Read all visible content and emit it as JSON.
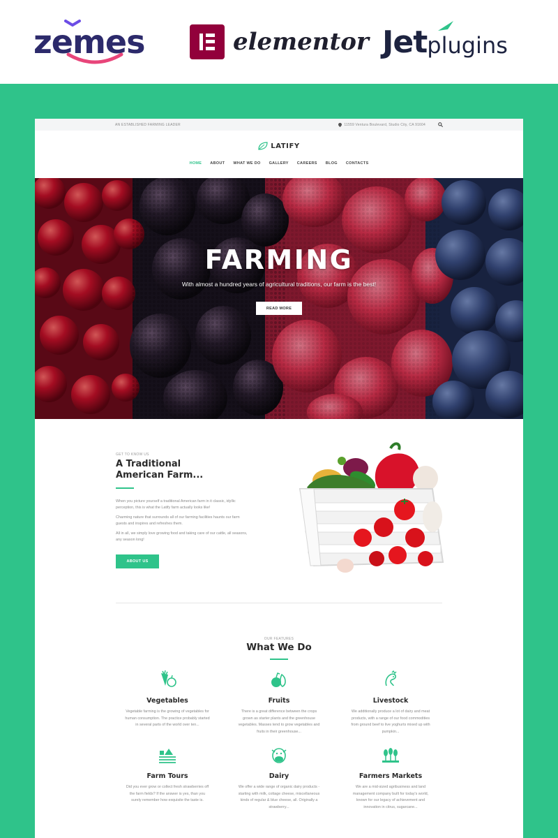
{
  "brand_bar": {
    "zemes": "zemes",
    "elementor": "elementor",
    "jet": "Jet",
    "plugins": "plugins"
  },
  "topbar": {
    "tagline": "AN ESTABLISHED FARMING LEADER",
    "address": "11559 Ventura Boulevard, Studio City, CA 91604"
  },
  "logo": {
    "text": "LATIFY"
  },
  "nav": {
    "items": [
      {
        "label": "HOME",
        "active": true
      },
      {
        "label": "ABOUT"
      },
      {
        "label": "WHAT WE DO"
      },
      {
        "label": "GALLERY"
      },
      {
        "label": "CAREERS"
      },
      {
        "label": "BLOG"
      },
      {
        "label": "CONTACTS"
      }
    ]
  },
  "hero": {
    "title": "FARMING",
    "subtitle": "With almost a hundred years of agricultural traditions, our farm is the best!",
    "button": "READ MORE"
  },
  "about": {
    "eyebrow": "GET TO KNOW US",
    "title_line1": "A Traditional",
    "title_line2": "American Farm...",
    "p1": "When you picture yourself a traditional American farm in it classic, idyllic perception, this is what the Latify farm actually looks like!",
    "p2": "Charming nature that surrounds all of our farming facilities haunts our farm guests and inspires and refreshes them.",
    "p3": "All in all, we simply love growing food and taking care of our cattle, all seasons, any season long!",
    "button": "ABOUT US"
  },
  "features": {
    "eyebrow": "OUR FEATURES",
    "title": "What We Do",
    "items": [
      {
        "icon": "vegetables-icon",
        "title": "Vegetables",
        "desc": "Vegetable farming is the growing of vegetables for human consumption. The practice probably started in several parts of the world over ten..."
      },
      {
        "icon": "fruits-icon",
        "title": "Fruits",
        "desc": "There is a great difference between the crops grown as starter plants and the greenhouse vegetables. Masses tend to grow vegetables and fruits in their greenhouse..."
      },
      {
        "icon": "livestock-icon",
        "title": "Livestock",
        "desc": "We additionally produce a lot of dairy and meat products, with a range of our food commodities from ground beef to live yoghurts mixed up with pumpkin..."
      },
      {
        "icon": "farm-tours-icon",
        "title": "Farm Tours",
        "desc": "Did you ever grow or collect fresh strawberries off the farm fields? If the answer is yes, than you surely remember how exquisite the taste is."
      },
      {
        "icon": "dairy-icon",
        "title": "Dairy",
        "desc": "We offer a wide range of organic dairy products - starting with milk, cottage cheese, miscellaneous kinds of regular & blue cheese, all. Originally a strawberry..."
      },
      {
        "icon": "farmers-markets-icon",
        "title": "Farmers Markets",
        "desc": "We are a mid-sized agribusiness and land management company built for today's world, known for our legacy of achievement and innovation in citrus, sugarcane..."
      }
    ]
  },
  "colors": {
    "accent": "#2fc38a",
    "elementor": "#92003b",
    "zemes_smile": "#e8457a",
    "jet_accent": "#2fc38a"
  }
}
